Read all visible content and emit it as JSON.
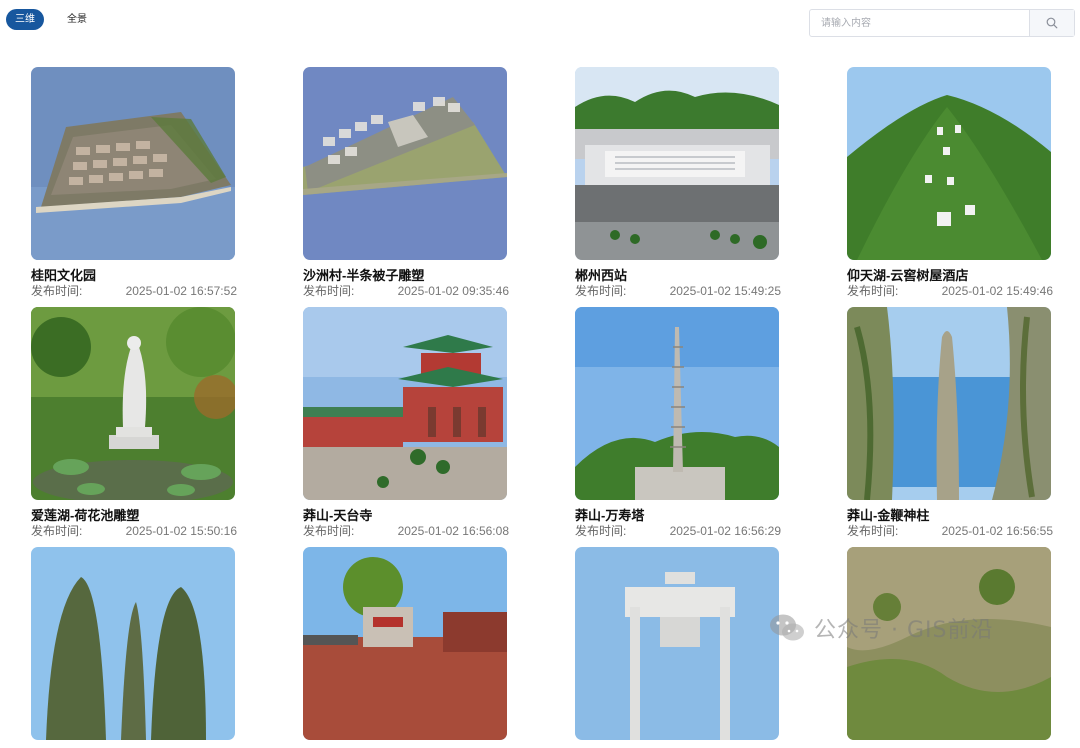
{
  "tabs": [
    {
      "label": "三维",
      "active": true
    },
    {
      "label": "全景",
      "active": false
    }
  ],
  "search": {
    "placeholder": "请输入内容",
    "icon": "search-icon"
  },
  "time_label": "发布时间:",
  "items": [
    {
      "title": "桂阳文化园",
      "time": "2025-01-02 16:57:52"
    },
    {
      "title": "沙洲村-半条被子雕塑",
      "time": "2025-01-02 09:35:46"
    },
    {
      "title": "郴州西站",
      "time": "2025-01-02 15:49:25"
    },
    {
      "title": "仰天湖-云窖树屋酒店",
      "time": "2025-01-02 15:49:46"
    },
    {
      "title": "爱莲湖-荷花池雕塑",
      "time": "2025-01-02 15:50:16"
    },
    {
      "title": "莽山-天台寺",
      "time": "2025-01-02 16:56:08"
    },
    {
      "title": "莽山-万寿塔",
      "time": "2025-01-02 16:56:29"
    },
    {
      "title": "莽山-金鞭神柱",
      "time": "2025-01-02 16:56:55"
    },
    {
      "title": "",
      "time": ""
    },
    {
      "title": "",
      "time": ""
    },
    {
      "title": "",
      "time": ""
    },
    {
      "title": "",
      "time": ""
    }
  ],
  "watermark": {
    "text": "公众号 · GIS前沿",
    "icon": "wechat-icon"
  }
}
